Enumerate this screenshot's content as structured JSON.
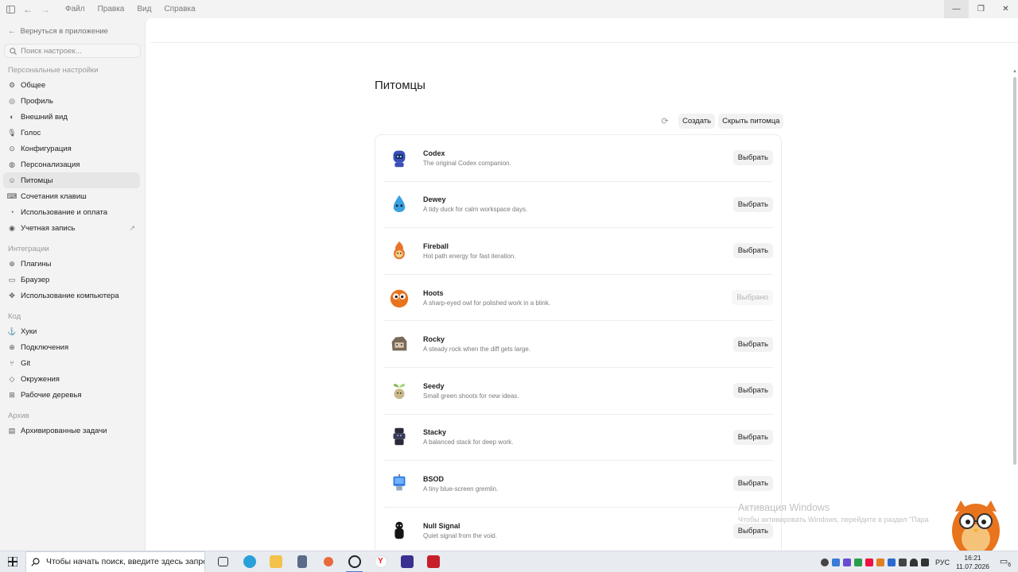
{
  "titlebar": {
    "menus": [
      "Файл",
      "Правка",
      "Вид",
      "Справка"
    ]
  },
  "sidebar": {
    "back_label": "Вернуться в приложение",
    "search_placeholder": "Поиск настроек...",
    "sections": [
      {
        "label": "Персональные настройки",
        "items": [
          {
            "label": "Общее",
            "icon": "gear-icon"
          },
          {
            "label": "Профиль",
            "icon": "profile-icon"
          },
          {
            "label": "Внешний вид",
            "icon": "appearance-icon"
          },
          {
            "label": "Голос",
            "icon": "mic-icon"
          },
          {
            "label": "Конфигурация",
            "icon": "config-icon"
          },
          {
            "label": "Персонализация",
            "icon": "personalization-icon"
          },
          {
            "label": "Питомцы",
            "icon": "pet-icon",
            "active": true
          },
          {
            "label": "Сочетания клавиш",
            "icon": "keyboard-icon"
          },
          {
            "label": "Использование и оплата",
            "icon": "usage-icon"
          },
          {
            "label": "Учетная запись",
            "icon": "account-icon",
            "external": true
          }
        ]
      },
      {
        "label": "Интеграции",
        "items": [
          {
            "label": "Плагины",
            "icon": "plugin-icon"
          },
          {
            "label": "Браузер",
            "icon": "browser-icon"
          },
          {
            "label": "Использование компьютера",
            "icon": "computer-use-icon"
          }
        ]
      },
      {
        "label": "Код",
        "items": [
          {
            "label": "Хуки",
            "icon": "hook-icon"
          },
          {
            "label": "Подключения",
            "icon": "globe-icon"
          },
          {
            "label": "Git",
            "icon": "git-icon"
          },
          {
            "label": "Окружения",
            "icon": "environment-icon"
          },
          {
            "label": "Рабочие деревья",
            "icon": "worktree-icon"
          }
        ]
      },
      {
        "label": "Архив",
        "items": [
          {
            "label": "Архивированные задачи",
            "icon": "archive-icon"
          }
        ]
      }
    ]
  },
  "main": {
    "title": "Питомцы",
    "create_label": "Создать",
    "hide_label": "Скрыть питомца",
    "pets": [
      {
        "name": "Codex",
        "desc": "The original Codex companion.",
        "action": "Выбрать",
        "selected": false,
        "color": "#3b4fb8"
      },
      {
        "name": "Dewey",
        "desc": "A tidy duck for calm workspace days.",
        "action": "Выбрать",
        "selected": false,
        "color": "#3aa0e0"
      },
      {
        "name": "Fireball",
        "desc": "Hot path energy for fast iteration.",
        "action": "Выбрать",
        "selected": false,
        "color": "#e8742a"
      },
      {
        "name": "Hoots",
        "desc": "A sharp-eyed owl for polished work in a blink.",
        "action": "Выбрано",
        "selected": true,
        "color": "#e8741e"
      },
      {
        "name": "Rocky",
        "desc": "A steady rock when the diff gets large.",
        "action": "Выбрать",
        "selected": false,
        "color": "#7a6a5a"
      },
      {
        "name": "Seedy",
        "desc": "Small green shoots for new ideas.",
        "action": "Выбрать",
        "selected": false,
        "color": "#c9b98a"
      },
      {
        "name": "Stacky",
        "desc": "A balanced stack for deep work.",
        "action": "Выбрать",
        "selected": false,
        "color": "#2a2a3a"
      },
      {
        "name": "BSOD",
        "desc": "A tiny blue-screen gremlin.",
        "action": "Выбрать",
        "selected": false,
        "color": "#2f7be0"
      },
      {
        "name": "Null Signal",
        "desc": "Quiet signal from the void.",
        "action": "Выбрать",
        "selected": false,
        "color": "#151515"
      }
    ]
  },
  "activation": {
    "title": "Активация Windows",
    "subtitle": "Чтобы активировать Windows, перейдите в раздел \"Пара"
  },
  "taskbar": {
    "search_placeholder": "Чтобы начать поиск, введите здесь запрос",
    "lang": "РУС",
    "time": "16:21",
    "date": "11.07.2026",
    "notification_count": "6"
  }
}
